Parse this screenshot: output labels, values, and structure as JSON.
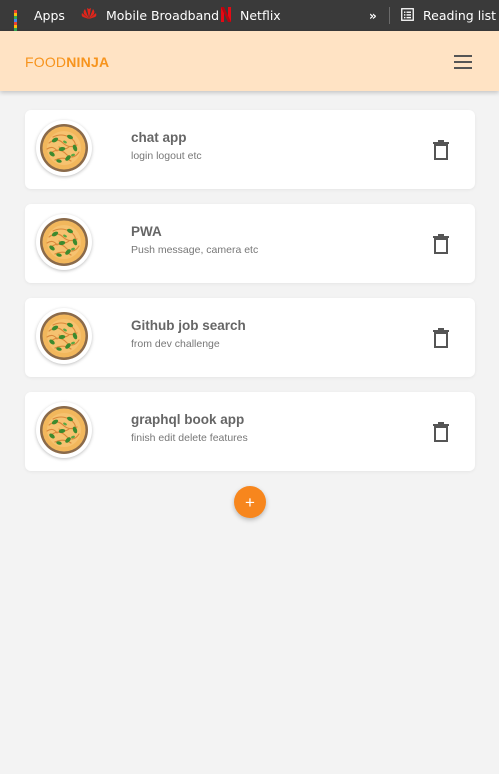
{
  "bookmarks": {
    "items": [
      {
        "label": "Apps",
        "icon": "apps-grid-icon"
      },
      {
        "label": "Mobile Broadband",
        "icon": "huawei-icon"
      },
      {
        "label": "Netflix",
        "icon": "netflix-icon"
      }
    ],
    "more_label": "»",
    "reading_list_label": "Reading list"
  },
  "header": {
    "brand_light": "FOOD",
    "brand_bold": "NINJA",
    "brand_color": "#f7941d",
    "background": "#ffe3c4"
  },
  "recipes": [
    {
      "title": "chat app",
      "description": "login logout etc"
    },
    {
      "title": "PWA",
      "description": "Push message, camera etc"
    },
    {
      "title": "Github job search",
      "description": "from dev challenge"
    },
    {
      "title": "graphql book app",
      "description": "finish edit delete features"
    }
  ],
  "fab": {
    "label": "+",
    "color": "#f7861d"
  },
  "icons": {
    "recipe_image": "pasta-dish-icon",
    "delete": "trash-icon",
    "menu": "hamburger-menu-icon"
  }
}
